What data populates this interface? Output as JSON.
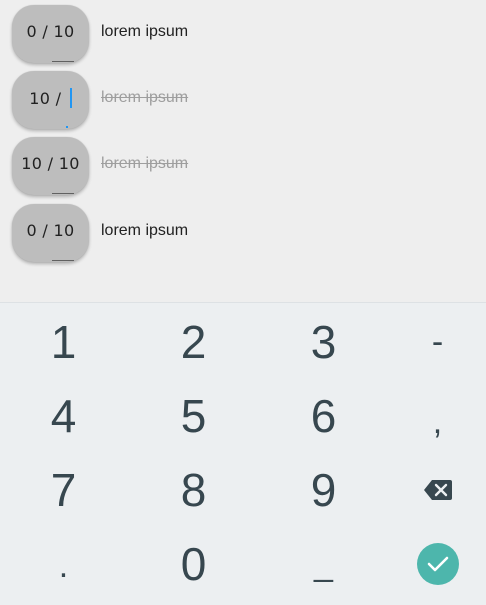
{
  "tasks": [
    {
      "done": "0",
      "sep": " / ",
      "total": "10",
      "label": "lorem ipsum",
      "completed": false,
      "focused": false
    },
    {
      "done": "10",
      "sep": " / ",
      "total": "",
      "label": "lorem ipsum",
      "completed": true,
      "focused": true
    },
    {
      "done": "10",
      "sep": " / ",
      "total": "10",
      "label": "lorem ipsum",
      "completed": true,
      "focused": false
    },
    {
      "done": "0",
      "sep": " / ",
      "total": "10",
      "label": "lorem ipsum",
      "completed": false,
      "focused": false
    }
  ],
  "keyboard": {
    "keys": {
      "k1": "1",
      "k2": "2",
      "k3": "3",
      "dash": "-",
      "k4": "4",
      "k5": "5",
      "k6": "6",
      "comma": ",",
      "k7": "7",
      "k8": "8",
      "k9": "9",
      "backspace": "backspace-icon",
      "period": ".",
      "k0": "0",
      "space": "_",
      "done": "check-icon"
    },
    "colors": {
      "background": "#eceff1",
      "key_text": "#37474f",
      "done_button": "#4db6ac",
      "cursor": "#2196f3"
    }
  }
}
